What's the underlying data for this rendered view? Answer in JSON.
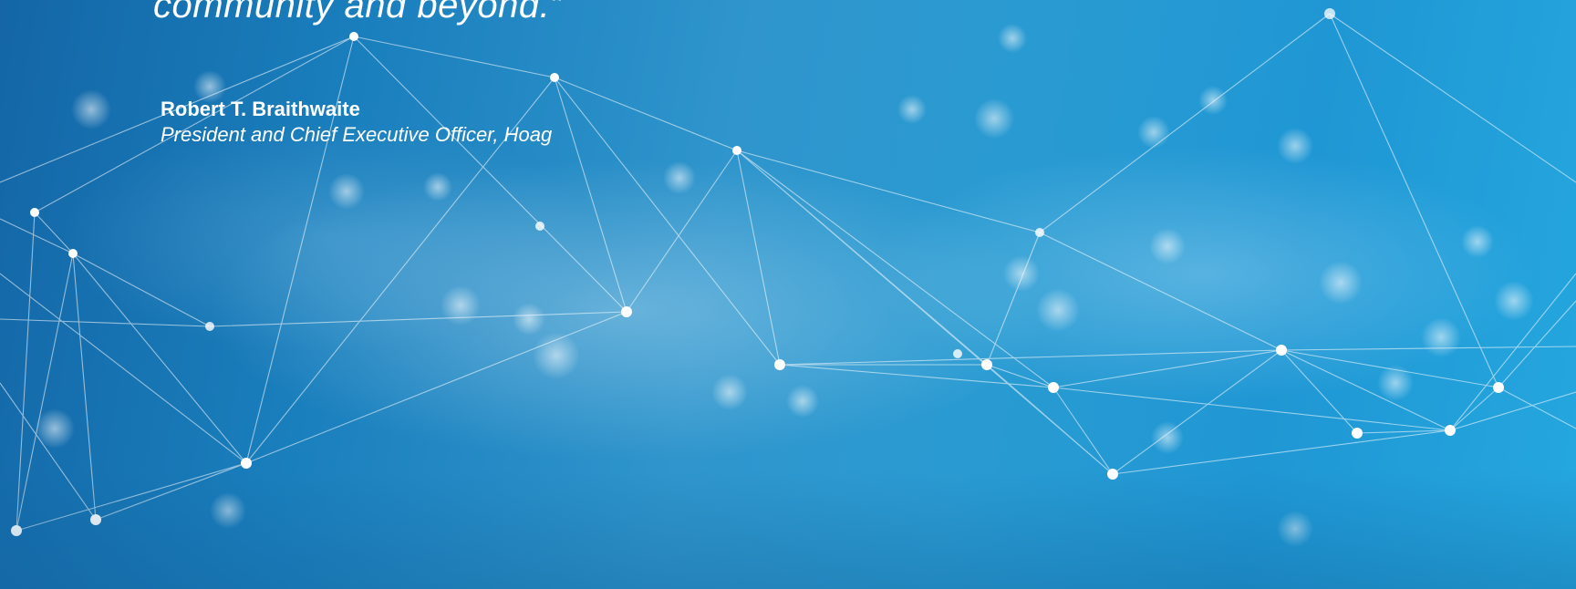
{
  "quote": {
    "closing_line": "community and beyond.”"
  },
  "attribution": {
    "name": "Robert T. Braithwaite",
    "title": "President and Chief Executive Officer, Hoag"
  },
  "background": {
    "icon": "network-mesh-icon",
    "colors": {
      "deep_blue": "#1466a6",
      "mid_blue": "#2f95cc",
      "light_blue": "#25a7df",
      "text": "#ffffff"
    }
  }
}
